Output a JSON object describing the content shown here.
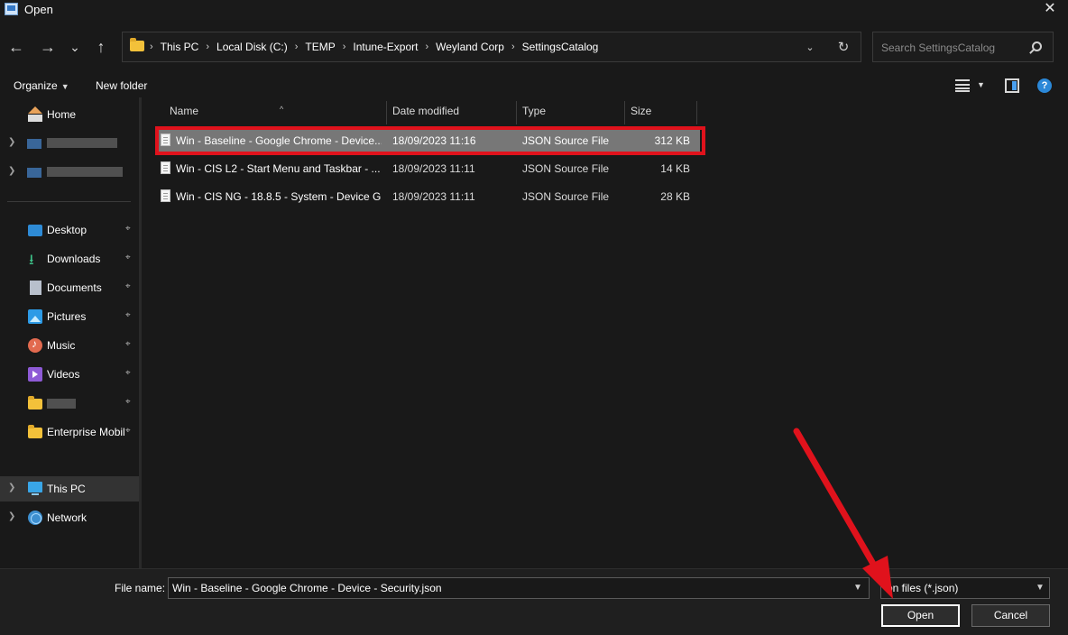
{
  "window": {
    "title": "Open",
    "close_glyph": "✕"
  },
  "nav": {
    "back_glyph": "←",
    "forward_glyph": "→",
    "recent_glyph": "⌄",
    "up_glyph": "↑"
  },
  "address": {
    "crumbs": [
      "This PC",
      "Local Disk (C:)",
      "TEMP",
      "Intune-Export",
      "Weyland Corp",
      "SettingsCatalog"
    ],
    "separator": "›"
  },
  "search": {
    "placeholder": "Search SettingsCatalog"
  },
  "toolbar": {
    "organize_label": "Organize",
    "new_folder_label": "New folder",
    "help_glyph": "?"
  },
  "sidebar": {
    "items": [
      {
        "label": "Home",
        "icon": "home-icon"
      },
      {
        "label": "",
        "icon": "onedrive-icon",
        "redacted": true
      },
      {
        "label": "",
        "icon": "onedrive-icon",
        "redacted": true
      },
      {
        "label": "Desktop",
        "icon": "desktop-icon",
        "pinned": true
      },
      {
        "label": "Downloads",
        "icon": "downloads-icon",
        "pinned": true
      },
      {
        "label": "Documents",
        "icon": "documents-icon",
        "pinned": true
      },
      {
        "label": "Pictures",
        "icon": "pictures-icon",
        "pinned": true
      },
      {
        "label": "Music",
        "icon": "music-icon",
        "pinned": true
      },
      {
        "label": "Videos",
        "icon": "videos-icon",
        "pinned": true
      },
      {
        "label": "",
        "icon": "folder-icon",
        "pinned": true,
        "redacted": true
      },
      {
        "label": "Enterprise Mobil",
        "icon": "folder-icon",
        "pinned": true
      },
      {
        "label": "This PC",
        "icon": "this-pc-icon",
        "selected": true
      },
      {
        "label": "Network",
        "icon": "network-icon"
      }
    ],
    "pin_glyph": "📌"
  },
  "columns": {
    "name": "Name",
    "date": "Date modified",
    "type": "Type",
    "size": "Size"
  },
  "files": [
    {
      "name": "Win - Baseline - Google Chrome - Device...",
      "date": "18/09/2023 11:16",
      "type": "JSON Source File",
      "size": "312 KB",
      "selected": true
    },
    {
      "name": "Win - CIS L2 - Start Menu and Taskbar - ...",
      "date": "18/09/2023 11:11",
      "type": "JSON Source File",
      "size": "14 KB"
    },
    {
      "name": "Win - CIS NG - 18.8.5 - System - Device G...",
      "date": "18/09/2023 11:11",
      "type": "JSON Source File",
      "size": "28 KB"
    }
  ],
  "bottom": {
    "file_name_label": "File name:",
    "file_name_value": "Win - Baseline - Google Chrome - Device - Security.json",
    "filter_value": "on files (*.json)",
    "open_label": "Open",
    "cancel_label": "Cancel"
  },
  "annotation_colors": {
    "highlight": "#e0121c",
    "arrow": "#e0121c"
  }
}
